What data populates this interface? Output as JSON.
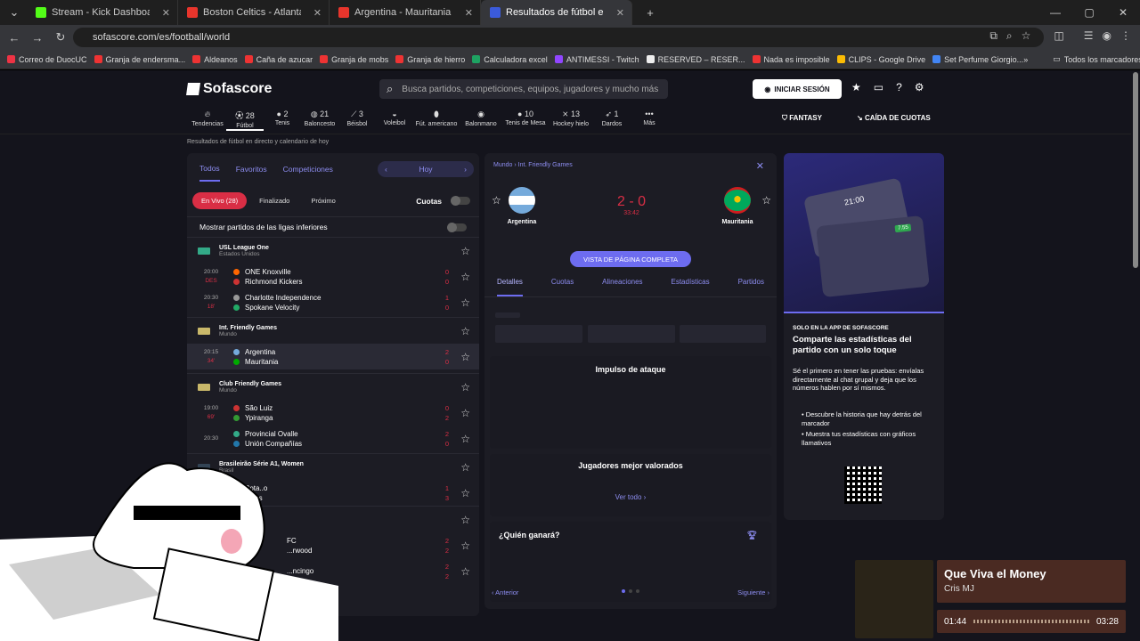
{
  "browser": {
    "tabs": [
      {
        "label": "Stream - Kick Dashboard",
        "color": "#53fc18"
      },
      {
        "label": "Boston Celtics - Atlanta Ha",
        "color": "#e8352c"
      },
      {
        "label": "Argentina - Mauritania Apuesta",
        "color": "#e8352c"
      },
      {
        "label": "Resultados de fútbol en directo",
        "color": "#3b5bdb"
      }
    ],
    "url": "sofascore.com/es/football/world",
    "bookmarks": [
      "Correo de DuocUC",
      "Granja de endersma...",
      "Aldeanos",
      "Caña de azucar",
      "Granja de mobs",
      "Granja de hierro",
      "Calculadora excel",
      "ANTIMESSI - Twitch",
      "RESERVED – RESER...",
      "Nada es imposible",
      "CLIPS - Google Drive",
      "Set Perfume Giorgio..."
    ],
    "bookmarks_folder": "Todos los marcadores"
  },
  "header": {
    "logo": "Sofascore",
    "search_placeholder": "Busca partidos, competiciones, equipos, jugadores y mucho más",
    "login": "INICIAR SESIÓN",
    "fantasy": "FANTASY",
    "caida": "CAÍDA DE CUOTAS",
    "subtitle": "Resultados de fútbol en directo y calendario de hoy"
  },
  "sports": [
    {
      "label": "Tendencias",
      "count": ""
    },
    {
      "label": "Fútbol",
      "count": "28"
    },
    {
      "label": "Tenis",
      "count": "2"
    },
    {
      "label": "Baloncesto",
      "count": "21"
    },
    {
      "label": "Béisbol",
      "count": "3"
    },
    {
      "label": "Voleibol",
      "count": ""
    },
    {
      "label": "Fút. americano",
      "count": ""
    },
    {
      "label": "Balonmano",
      "count": ""
    },
    {
      "label": "Tenis de Mesa",
      "count": "10"
    },
    {
      "label": "Hockey hielo",
      "count": "13"
    },
    {
      "label": "Dardos",
      "count": "1"
    },
    {
      "label": "Más",
      "count": ""
    }
  ],
  "left": {
    "tabs": [
      "Todos",
      "Favoritos",
      "Competiciones"
    ],
    "day": "Hoy",
    "chips": [
      "En Vivo (28)",
      "Finalizado",
      "Próximo"
    ],
    "cuotas": "Cuotas",
    "lower_leagues": "Mostrar partidos de las ligas inferiores",
    "leagues": [
      {
        "name": "USL League One",
        "country": "Estados Unidos",
        "matches": [
          {
            "time": "20:00",
            "status": "DES",
            "home": "ONE Knoxville",
            "away": "Richmond Kickers",
            "hs": "0",
            "as": "0"
          },
          {
            "time": "20:30",
            "status": "18'",
            "home": "Charlotte Independence",
            "away": "Spokane Velocity",
            "hs": "1",
            "as": "0"
          }
        ]
      },
      {
        "name": "Int. Friendly Games",
        "country": "Mundo",
        "matches": [
          {
            "time": "20:15",
            "status": "34'",
            "home": "Argentina",
            "away": "Mauritania",
            "hs": "2",
            "as": "0"
          }
        ]
      },
      {
        "name": "Club Friendly Games",
        "country": "Mundo",
        "matches": [
          {
            "time": "19:00",
            "status": "69'",
            "home": "São Luiz",
            "away": "Ypiranga",
            "hs": "0",
            "as": "2"
          },
          {
            "time": "20:30",
            "status": "",
            "home": "Provincial Ovalle",
            "away": "Unión Compañías",
            "hs": "2",
            "as": "0"
          }
        ]
      },
      {
        "name": "Brasileirão Série A1, Women",
        "country": "Brasil",
        "matches": [
          {
            "time": "",
            "status": "",
            "home": "Bota..o",
            "away": "...ans",
            "hs": "1",
            "as": "3"
          }
        ]
      }
    ],
    "partial_rows": [
      {
        "home": "FC",
        "away": "...rwood",
        "hs": "2",
        "as": "2"
      },
      {
        "home": "...ncingo",
        "away": "",
        "hs": "2",
        "as": "2"
      }
    ]
  },
  "detail": {
    "breadcrumb": "Mundo  ›  Int. Friendly Games",
    "home": "Argentina",
    "away": "Mauritania",
    "score": "2 - 0",
    "clock": "33:42",
    "full_page": "VISTA DE PÁGINA COMPLETA",
    "tabs": [
      "Detalles",
      "Cuotas",
      "Alineaciones",
      "Estadísticas",
      "Partidos"
    ],
    "momentum": "Impulso de ataque",
    "top_players": "Jugadores mejor valorados",
    "ver_todo": "Ver todo",
    "who_wins": "¿Quién ganará?",
    "prev": "Anterior",
    "next": "Siguiente"
  },
  "promo": {
    "kicker": "SOLO EN LA APP DE SOFASCORE",
    "title": "Comparte las estadísticas del partido con un solo toque",
    "body": "Sé el primero en tener las pruebas: envíalas directamente al chat grupal y deja que los números hablen por sí mismos.",
    "bullet1": "Descubre la historia que hay detrás del marcador",
    "bullet2": "Muestra tus estadísticas con gráficos llamativos",
    "card_time": "21:00",
    "card_value": "7.55"
  },
  "music": {
    "title": "Que Viva el Money",
    "artist": "Cris MJ",
    "elapsed": "01:44",
    "total": "03:28",
    "progress": 0.5
  }
}
